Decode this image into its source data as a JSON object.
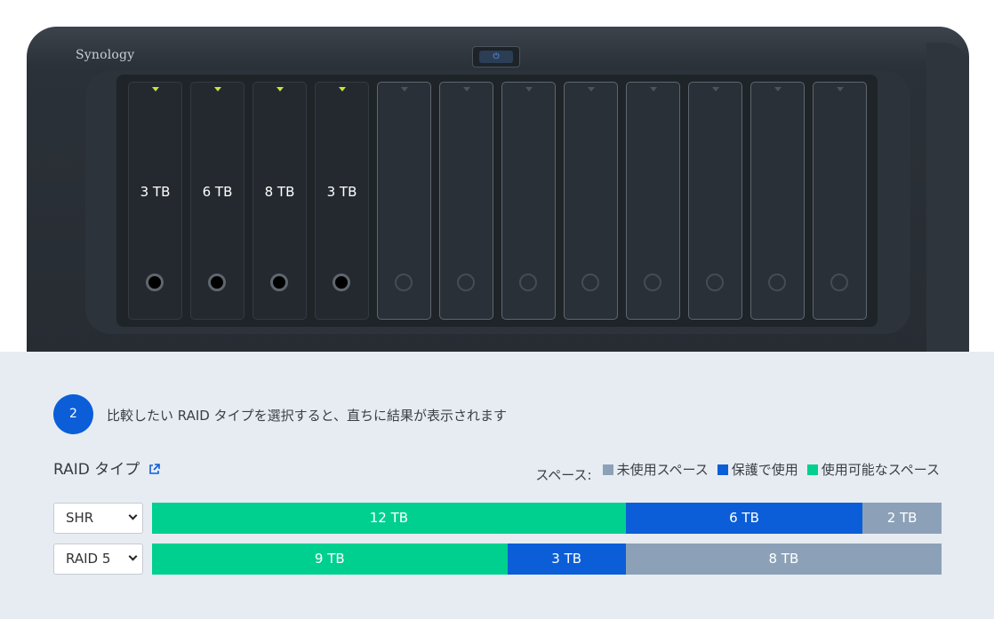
{
  "device": {
    "brand": "Synology",
    "drives": [
      {
        "capacity": "3 TB",
        "installed": true
      },
      {
        "capacity": "6 TB",
        "installed": true
      },
      {
        "capacity": "8 TB",
        "installed": true
      },
      {
        "capacity": "3 TB",
        "installed": true
      },
      {
        "capacity": "",
        "installed": false
      },
      {
        "capacity": "",
        "installed": false
      },
      {
        "capacity": "",
        "installed": false
      },
      {
        "capacity": "",
        "installed": false
      },
      {
        "capacity": "",
        "installed": false
      },
      {
        "capacity": "",
        "installed": false
      },
      {
        "capacity": "",
        "installed": false
      },
      {
        "capacity": "",
        "installed": false
      }
    ]
  },
  "step": {
    "number": "2",
    "text": "比較したい RAID タイプを選択すると、直ちに結果が表示されます"
  },
  "raid": {
    "title": "RAID タイプ",
    "legend_title": "スペース:",
    "legend": [
      {
        "label": "未使用スペース",
        "color": "#8ca1b8"
      },
      {
        "label": "保護で使用",
        "color": "#0b5ed7"
      },
      {
        "label": "使用可能なスペース",
        "color": "#00d08f"
      }
    ],
    "rows": [
      {
        "type": "SHR",
        "segments": [
          {
            "label": "12 TB",
            "tb": 12,
            "color": "#00d08f"
          },
          {
            "label": "6 TB",
            "tb": 6,
            "color": "#0b5ed7"
          },
          {
            "label": "2 TB",
            "tb": 2,
            "color": "#8ca1b8"
          }
        ]
      },
      {
        "type": "RAID 5",
        "segments": [
          {
            "label": "9 TB",
            "tb": 9,
            "color": "#00d08f"
          },
          {
            "label": "3 TB",
            "tb": 3,
            "color": "#0b5ed7"
          },
          {
            "label": "8 TB",
            "tb": 8,
            "color": "#8ca1b8"
          }
        ]
      }
    ]
  }
}
